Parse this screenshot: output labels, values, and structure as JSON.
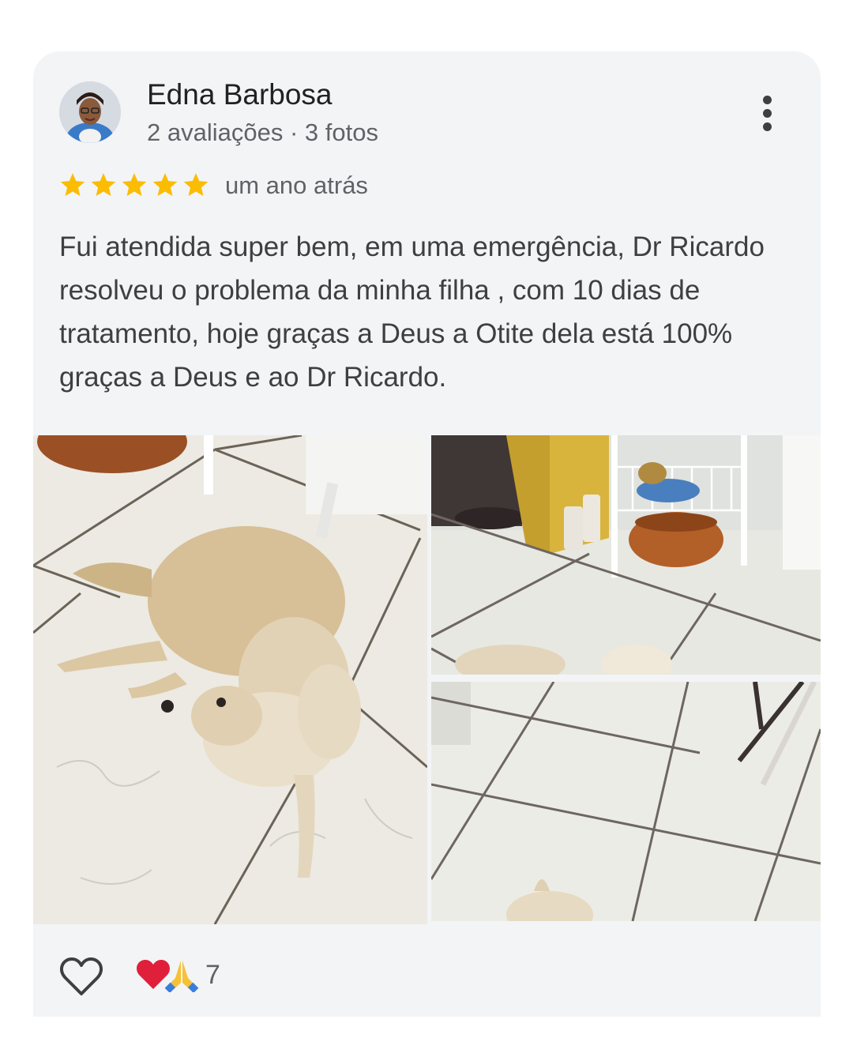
{
  "review": {
    "author": {
      "name": "Edna Barbosa",
      "meta": "2 avaliações · 3 fotos"
    },
    "rating": 5,
    "time": "um ano atrás",
    "text": "Fui atendida super bem, em uma emergência, Dr Ricardo resolveu o problema da minha filha , com 10 dias de tratamento, hoje graças a Deus a Otite dela está 100% graças a Deus e ao Dr Ricardo.",
    "photos": [
      "dog-lying-on-tile-floor",
      "kitchen-corner-with-dog",
      "tile-floor-with-dog"
    ],
    "reactions": {
      "icons": [
        "heart-icon",
        "praying-hands-icon"
      ],
      "count": "7"
    }
  },
  "colors": {
    "card": "#f3f4f6",
    "star": "#fbbc04",
    "text": "#3c4043",
    "secondary": "#5f6368",
    "heart": "#e0203a"
  }
}
